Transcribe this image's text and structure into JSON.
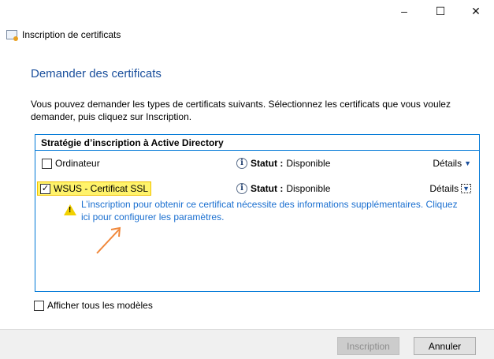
{
  "window": {
    "title": "Inscription de certificats",
    "minimize": "–",
    "maximize": "☐",
    "close": "✕"
  },
  "heading": "Demander des certificats",
  "description": "Vous pouvez demander les types de certificats suivants. Sélectionnez les certificats que vous voulez demander, puis cliquez sur Inscription.",
  "policy": {
    "title": "Stratégie d’inscription à Active Directory",
    "items": [
      {
        "name": "Ordinateur",
        "checked": false,
        "status_label": "Statut :",
        "status": "Disponible",
        "details": "Détails"
      },
      {
        "name": "WSUS - Certificat SSL",
        "checked": true,
        "status_label": "Statut :",
        "status": "Disponible",
        "details": "Détails"
      }
    ],
    "warning": "L’inscription pour obtenir ce certificat nécessite des informations supplémentaires. Cliquez ici pour configurer les paramètres."
  },
  "show_all": "Afficher tous les modèles",
  "buttons": {
    "enroll": "Inscription",
    "cancel": "Annuler"
  }
}
